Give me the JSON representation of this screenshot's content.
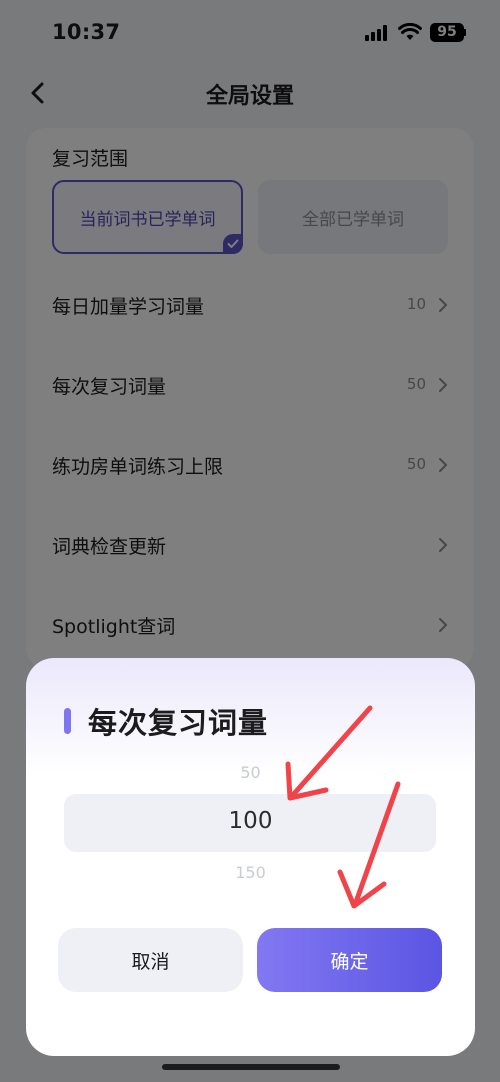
{
  "status_bar": {
    "time": "10:37",
    "battery": "95"
  },
  "nav": {
    "title": "全局设置"
  },
  "review_range": {
    "title": "复习范围",
    "options": [
      {
        "label": "当前词书已学单词",
        "selected": true
      },
      {
        "label": "全部已学单词",
        "selected": false
      }
    ]
  },
  "settings": [
    {
      "label": "每日加量学习词量",
      "value": "10"
    },
    {
      "label": "每次复习词量",
      "value": "50"
    },
    {
      "label": "练功房单词练习上限",
      "value": "50"
    },
    {
      "label": "词典检查更新",
      "value": ""
    },
    {
      "label": "Spotlight查词",
      "value": ""
    }
  ],
  "sheet": {
    "title": "每次复习词量",
    "picker_options": [
      "50",
      "100",
      "150"
    ],
    "picker_selected": "100",
    "cancel_label": "取消",
    "confirm_label": "确定"
  },
  "colors": {
    "accent": "#5b54c9",
    "annotation_arrow": "#f0434a"
  }
}
